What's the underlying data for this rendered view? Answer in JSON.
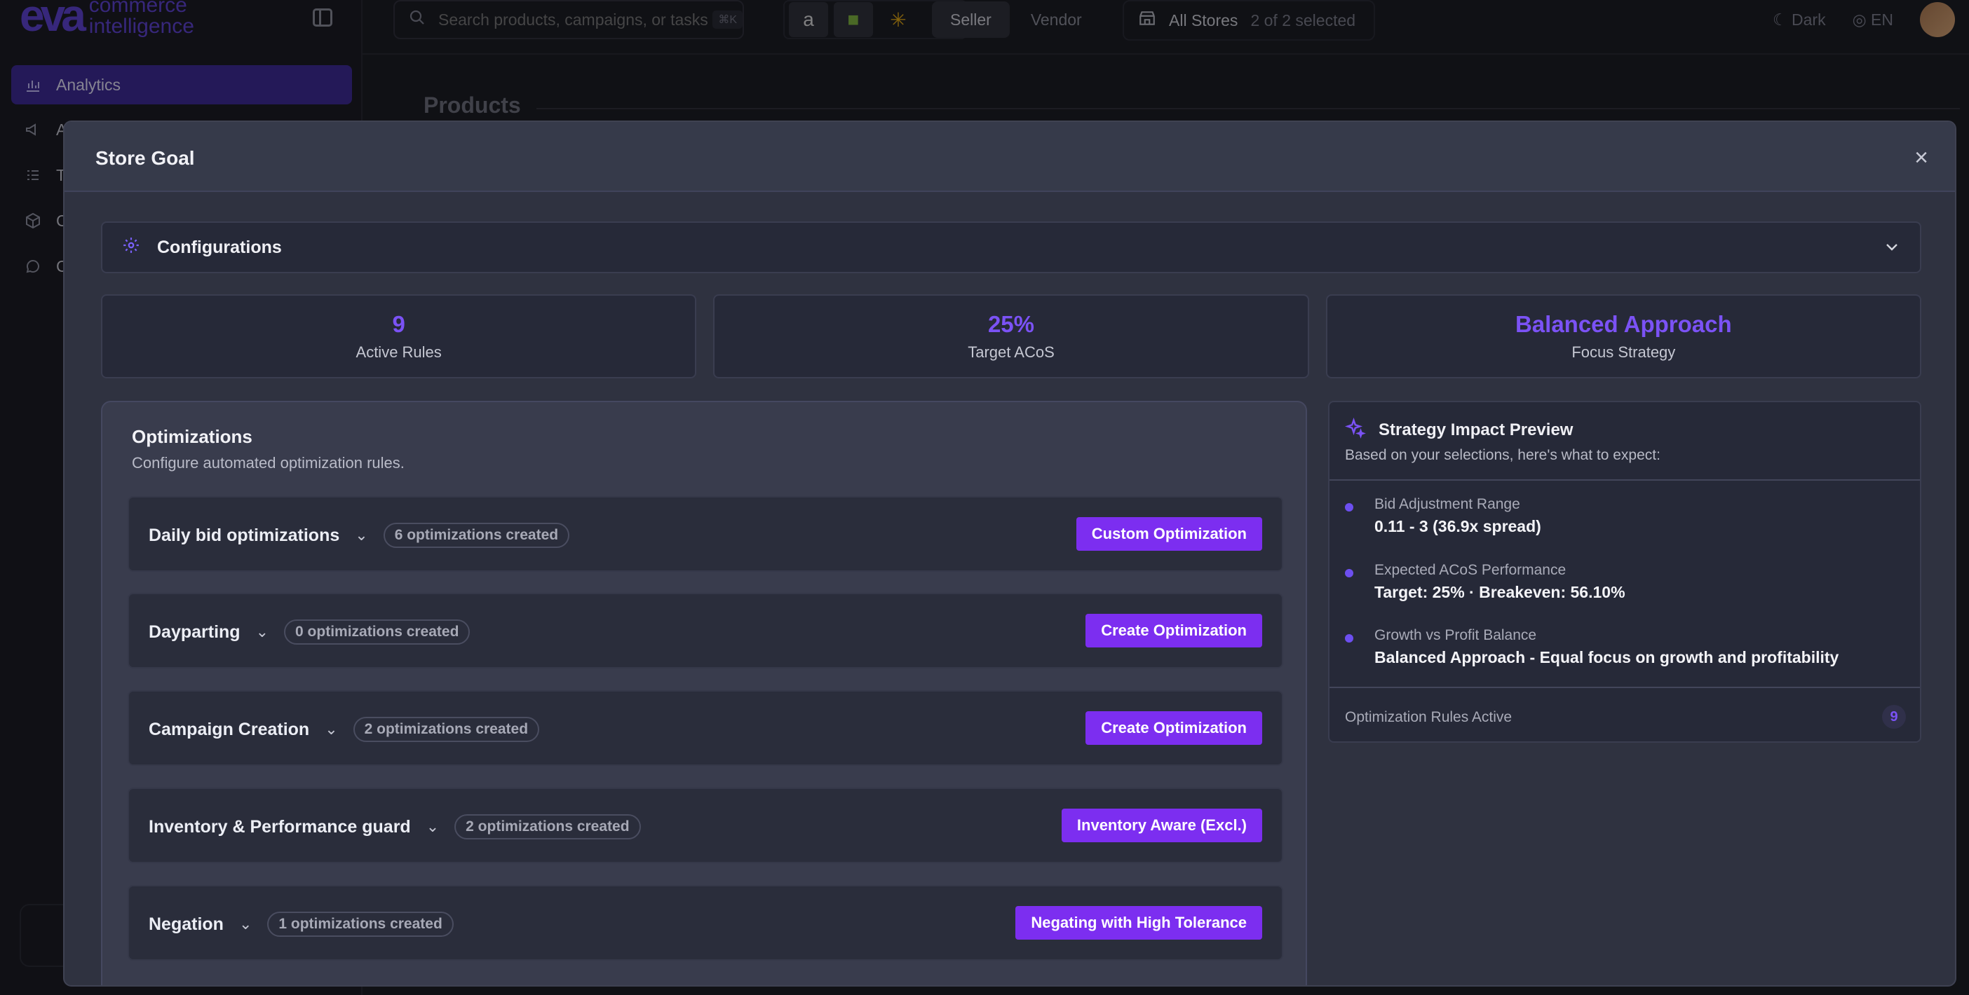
{
  "app": {
    "logo_mark": "eva",
    "logo_text_1": "commerce",
    "logo_text_2": "intelligence"
  },
  "sidebar": {
    "items": [
      {
        "label": "Analytics",
        "icon": "bar-chart-icon",
        "active": true
      },
      {
        "label": "A",
        "icon": "megaphone-icon"
      },
      {
        "label": "T",
        "icon": "list-icon"
      },
      {
        "label": "C",
        "icon": "box-icon"
      },
      {
        "label": "C",
        "icon": "chat-icon"
      }
    ]
  },
  "topbar": {
    "search_placeholder": "Search products, campaigns, or tasks",
    "search_shortcut": "⌘K",
    "marketplaces": [
      "amazon",
      "shopify",
      "walmart"
    ],
    "account_types": [
      "Seller",
      "Vendor"
    ],
    "active_account_type": "Seller",
    "stores_label": "All Stores",
    "stores_selected": "2 of 2 selected",
    "theme_label": "Dark",
    "language_label": "EN"
  },
  "page": {
    "heading": "Products"
  },
  "modal": {
    "title": "Store Goal",
    "configurations_label": "Configurations",
    "stats": [
      {
        "value": "9",
        "caption": "Active Rules"
      },
      {
        "value": "25%",
        "caption": "Target ACoS"
      },
      {
        "value": "Balanced Approach",
        "caption": "Focus Strategy"
      }
    ],
    "optimizations": {
      "title": "Optimizations",
      "description": "Configure automated optimization rules.",
      "rows": [
        {
          "name": "Daily bid optimizations",
          "badge": "6 optimizations created",
          "button": "Custom Optimization"
        },
        {
          "name": "Dayparting",
          "badge": "0 optimizations created",
          "button": "Create Optimization"
        },
        {
          "name": "Campaign Creation",
          "badge": "2 optimizations created",
          "button": "Create Optimization"
        },
        {
          "name": "Inventory & Performance guard",
          "badge": "2 optimizations created",
          "button": "Inventory Aware (Excl.)"
        },
        {
          "name": "Negation",
          "badge": "1 optimizations created",
          "button": "Negating with High Tolerance"
        }
      ]
    },
    "impact": {
      "title": "Strategy Impact Preview",
      "subtitle": "Based on your selections, here's what to expect:",
      "items": [
        {
          "label": "Bid Adjustment Range",
          "value": "0.11 - 3 (36.9x spread)"
        },
        {
          "label": "Expected ACoS Performance",
          "value": "Target: 25% · Breakeven: 56.10%"
        },
        {
          "label": "Growth vs Profit Balance",
          "value": "Balanced Approach - Equal focus on growth and profitability"
        }
      ],
      "footer_label": "Optimization Rules Active",
      "footer_count": "9"
    }
  },
  "colors": {
    "accent": "#7b52f5",
    "button": "#7c2ef0",
    "modal_bg": "#2f3240",
    "card_bg": "#262938"
  }
}
